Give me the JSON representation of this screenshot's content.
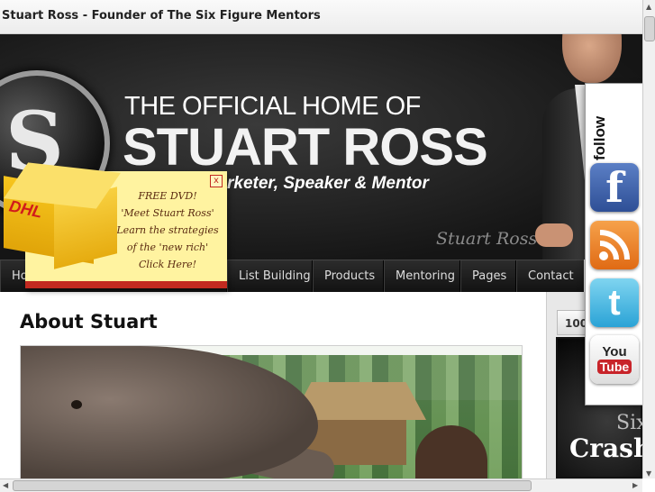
{
  "window": {
    "title": "Stuart Ross - Founder of The Six Figure Mentors"
  },
  "header": {
    "logo_initials": "S",
    "kicker": "THE OFFICIAL HOME OF",
    "name": "STUART ROSS",
    "tagline": "rketer, Speaker & Mentor",
    "signature": "Stuart Ross"
  },
  "popup": {
    "box_brand": "DHL",
    "close_symbol": "x",
    "text_lines": [
      "FREE DVD!",
      "'Meet Stuart Ross'",
      "Learn the strategies",
      "of the 'new rich'",
      "Click Here!"
    ]
  },
  "nav": {
    "items": [
      {
        "label": "Ho"
      },
      {
        "label": "List Building"
      },
      {
        "label": "Products"
      },
      {
        "label": "Mentoring"
      },
      {
        "label": "Pages"
      },
      {
        "label": "Contact"
      }
    ]
  },
  "main": {
    "heading": "About Stuart"
  },
  "sidebar": {
    "tab_label": "100",
    "banner_line1": "Six",
    "banner_line2": "Crash"
  },
  "follow_bar": {
    "label": "follow",
    "buttons": [
      {
        "name": "facebook",
        "glyph": "f"
      },
      {
        "name": "rss",
        "glyph": ""
      },
      {
        "name": "twitter",
        "glyph": "t"
      },
      {
        "name": "youtube",
        "glyph_top": "You",
        "glyph_bottom": "Tube"
      }
    ]
  },
  "colors": {
    "nav_bg": "#1a1a1a",
    "popup_bg": "#fff3a0",
    "accent_red": "#c22a20",
    "facebook": "#3b5998",
    "rss": "#f08a24",
    "twitter": "#33b5e5"
  }
}
